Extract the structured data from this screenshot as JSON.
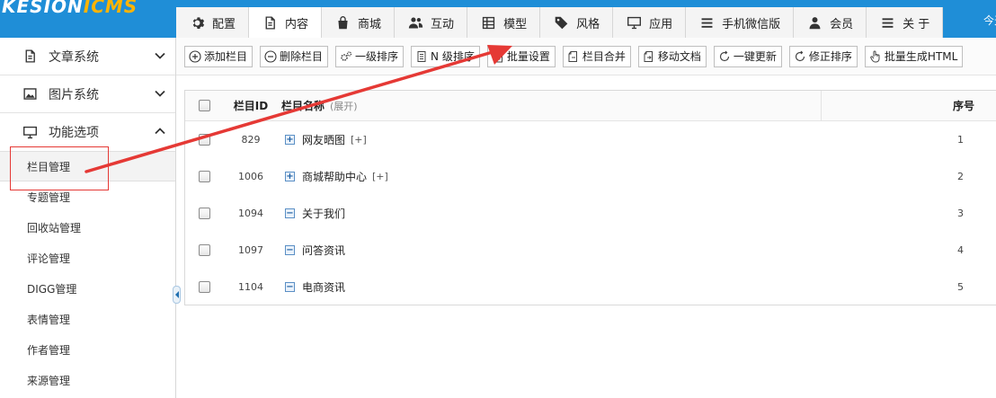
{
  "app": {
    "logo_main": "KESION",
    "logo_accent": "ICMS",
    "top_right_text": "今天"
  },
  "nav_tabs": [
    {
      "label": "配置",
      "icon": "gear-icon"
    },
    {
      "label": "内容",
      "icon": "document-icon",
      "active": true
    },
    {
      "label": "商城",
      "icon": "shopping-bag-icon"
    },
    {
      "label": "互动",
      "icon": "users-icon"
    },
    {
      "label": "模型",
      "icon": "grid-icon"
    },
    {
      "label": "风格",
      "icon": "tag-icon"
    },
    {
      "label": "应用",
      "icon": "monitor-icon"
    },
    {
      "label": "手机微信版",
      "icon": "menu-icon"
    },
    {
      "label": "会员",
      "icon": "user-icon"
    },
    {
      "label": "关 于",
      "icon": "menu-icon"
    }
  ],
  "sidebar": {
    "groups": [
      {
        "label": "文章系统",
        "icon": "document-icon",
        "expanded": false
      },
      {
        "label": "图片系统",
        "icon": "image-icon",
        "expanded": false
      },
      {
        "label": "功能选项",
        "icon": "monitor-icon",
        "expanded": true
      }
    ],
    "items": [
      {
        "label": "栏目管理",
        "active": true
      },
      {
        "label": "专题管理"
      },
      {
        "label": "回收站管理"
      },
      {
        "label": "评论管理"
      },
      {
        "label": "DIGG管理"
      },
      {
        "label": "表情管理"
      },
      {
        "label": "作者管理"
      },
      {
        "label": "来源管理"
      }
    ]
  },
  "toolbar": {
    "buttons": [
      {
        "label": "添加栏目",
        "icon": "plus-circle-icon"
      },
      {
        "label": "删除栏目",
        "icon": "minus-circle-icon"
      },
      {
        "label": "一级排序",
        "icon": "gears-icon"
      },
      {
        "label": "N 级排序",
        "icon": "list-icon"
      },
      {
        "label": "批量设置",
        "icon": "clipboard-icon"
      },
      {
        "label": "栏目合并",
        "icon": "merge-icon"
      },
      {
        "label": "移动文档",
        "icon": "move-icon"
      },
      {
        "label": "一键更新",
        "icon": "refresh-icon"
      },
      {
        "label": "修正排序",
        "icon": "refresh-icon"
      },
      {
        "label": "批量生成HTML",
        "icon": "hand-pointer-icon"
      }
    ]
  },
  "table": {
    "headers": {
      "id": "栏目ID",
      "name": "栏目名称",
      "name_sub": "(展开)",
      "order": "序号"
    },
    "rows": [
      {
        "id": "829",
        "name": "网友晒图",
        "more": "[+]",
        "order": "1",
        "expand": "+"
      },
      {
        "id": "1006",
        "name": "商城帮助中心",
        "more": "[+]",
        "order": "2",
        "expand": "+"
      },
      {
        "id": "1094",
        "name": "关于我们",
        "more": "",
        "order": "3",
        "expand": "−"
      },
      {
        "id": "1097",
        "name": "问答资讯",
        "more": "",
        "order": "4",
        "expand": "−"
      },
      {
        "id": "1104",
        "name": "电商资讯",
        "more": "",
        "order": "5",
        "expand": "−"
      }
    ]
  },
  "colors": {
    "topbar": "#1f8ed7",
    "annotation": "#e53935"
  }
}
